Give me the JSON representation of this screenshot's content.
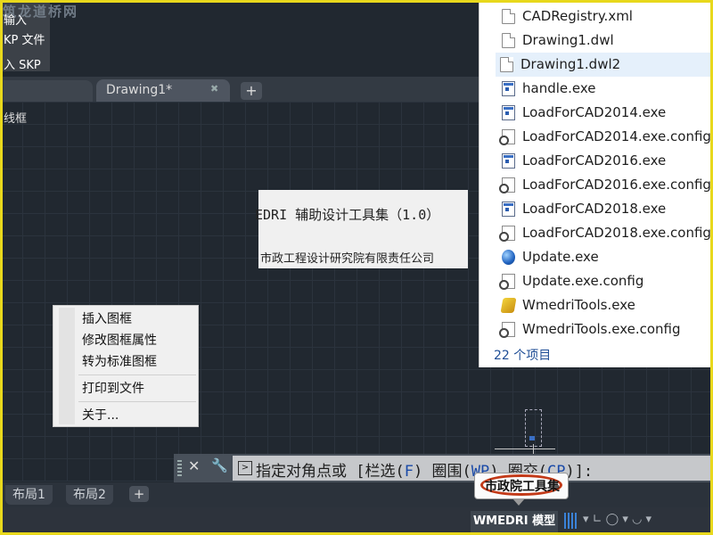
{
  "top_left": {
    "watermark": "筑龙道桥网",
    "line1": "输入",
    "line2": "KP 文件",
    "line3": "入 SKP"
  },
  "tabs": {
    "active_label": "Drawing1*",
    "close_glyph": "✖",
    "add_glyph": "+"
  },
  "viewport": {
    "label": "线框"
  },
  "info_box": {
    "title": "EDRI 辅助设计工具集（1.0）",
    "company": "市政工程设计研究院有限责任公司"
  },
  "context_menu": {
    "items": [
      "插入图框",
      "修改图框属性",
      "转为标准图框",
      "打印到文件",
      "关于..."
    ]
  },
  "file_list": {
    "files": [
      {
        "name": "CADRegistry.xml",
        "icon": "document-icon"
      },
      {
        "name": "Drawing1.dwl",
        "icon": "document-icon"
      },
      {
        "name": "Drawing1.dwl2",
        "icon": "document-icon"
      },
      {
        "name": "handle.exe",
        "icon": "exe-icon"
      },
      {
        "name": "LoadForCAD2014.exe",
        "icon": "exe-icon"
      },
      {
        "name": "LoadForCAD2014.exe.config",
        "icon": "config-icon"
      },
      {
        "name": "LoadForCAD2016.exe",
        "icon": "exe-icon"
      },
      {
        "name": "LoadForCAD2016.exe.config",
        "icon": "config-icon"
      },
      {
        "name": "LoadForCAD2018.exe",
        "icon": "exe-icon"
      },
      {
        "name": "LoadForCAD2018.exe.config",
        "icon": "config-icon"
      },
      {
        "name": "Update.exe",
        "icon": "globe-icon"
      },
      {
        "name": "Update.exe.config",
        "icon": "config-icon"
      },
      {
        "name": "WmedriTools.exe",
        "icon": "ribbon-icon"
      },
      {
        "name": "WmedriTools.exe.config",
        "icon": "config-icon"
      }
    ],
    "selected_index": 2,
    "count_label": "22 个项目"
  },
  "command_line": {
    "close_glyph": "✕",
    "wrench_glyph": "🔧",
    "prompt": "指定对角点或 [",
    "opt1": "栏选(",
    "opt1_key": "F",
    "opt1_end": ")",
    "opt2": "圈围(",
    "opt2_key": "WP",
    "opt2_end": ")",
    "opt3": "圈交(",
    "opt3_key": "CP",
    "opt3_end": ")]:"
  },
  "layout_tabs": {
    "tab1": "布局1",
    "tab2": "布局2",
    "add_glyph": "+"
  },
  "status_bar": {
    "model_label": "WMEDRI 模型",
    "misc": "▾ ∟ ◯ ▾ ◡ ▾"
  },
  "tooltip": {
    "text": "市政院工具集"
  },
  "colors": {
    "frame": "#e8d81c",
    "canvas": "#212830",
    "highlight_oval": "#c33a18",
    "command_key": "#1a4aa8"
  }
}
